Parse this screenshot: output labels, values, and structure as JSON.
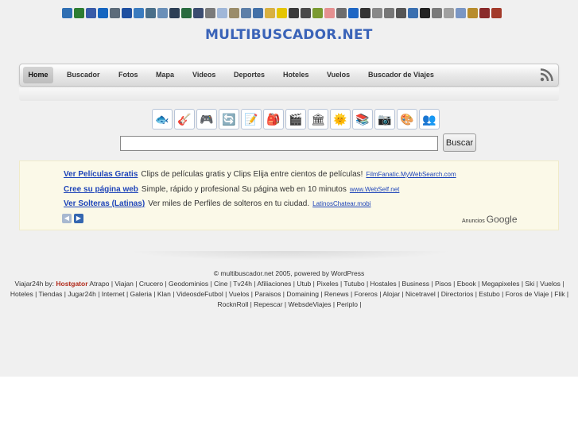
{
  "top_icons": [
    "#2f6fb3",
    "#2e7d32",
    "#385ba8",
    "#1565c0",
    "#5c6b7a",
    "#1e4fa0",
    "#3a7bbf",
    "#4a6f8a",
    "#6a8fb8",
    "#2d3f55",
    "#2a6b3f",
    "#3b4c70",
    "#7a7a7a",
    "#a0b7d8",
    "#9a8c6a",
    "#5d7fa8",
    "#4270a8",
    "#d8b040",
    "#e5c500",
    "#3a3a3a",
    "#4a4a4a",
    "#7a9a30",
    "#e59090",
    "#6d6d6d",
    "#1e66c4",
    "#333333",
    "#888888",
    "#777777",
    "#555555",
    "#3a6fb0",
    "#222222",
    "#7a7a7a",
    "#a0a0a0",
    "#7a96c4",
    "#b88c2c",
    "#8a2a2a",
    "#a33a2a"
  ],
  "logo": "MULTIBUSCADOR.NET",
  "nav": {
    "items": [
      "Home",
      "Buscador",
      "Fotos",
      "Mapa",
      "Videos",
      "Deportes",
      "Hoteles",
      "Vuelos",
      "Buscador de Viajes"
    ],
    "active": "Home",
    "rss_icon": "rss-icon"
  },
  "category_icons": [
    "🐟",
    "🎸",
    "🎮",
    "🔄",
    "📝",
    "🎒",
    "🎬",
    "🏛",
    "🌞",
    "📚",
    "📷",
    "🎨",
    "👥"
  ],
  "search": {
    "value": "",
    "button_label": "Buscar"
  },
  "ads": [
    {
      "title": "Ver Películas Gratis",
      "text": "Clips de películas gratis y Clips Elija entre cientos de películas!",
      "url": "FilmFanatic.MyWebSearch.com"
    },
    {
      "title": "Cree su página web",
      "text": "Simple, rápido y profesional Su página web en 10 minutos",
      "url": "www.WebSelf.net"
    },
    {
      "title": "Ver Solteras (Latinas)",
      "text": "Ver miles de Perfiles de solteros en tu ciudad.",
      "url": "LatinosChatear.mobi"
    }
  ],
  "ads_label": "Anuncios",
  "ads_brand": "Google",
  "copyright": "© multibuscador.net 2005, powered by WordPress",
  "footer": {
    "prefix": "Viajar24h by:",
    "sponsor": "Hostgator",
    "links": [
      "Atrapo",
      "Viajan",
      "Crucero",
      "Geodominios",
      "Cine",
      "Tv24h",
      "Afiliaciones",
      "Utub",
      "Pixeles",
      "Tutubo",
      "Hostales",
      "Business",
      "Pisos",
      "Ebook",
      "Megapixeles",
      "Ski",
      "Vuelos",
      "Hoteles",
      "Tiendas",
      "Jugar24h",
      "Internet",
      "Galeria",
      "Klan",
      "VideosdeFutbol",
      "Vuelos",
      "Paraisos",
      "Domaining",
      "Renews",
      "Foreros",
      "Alojar",
      "Nicetravel",
      "Directorios",
      "Estubo",
      "Foros de Viaje",
      "Flik",
      "RocknRoll",
      "Repescar",
      "WebsdeViajes",
      "Periplo"
    ]
  }
}
